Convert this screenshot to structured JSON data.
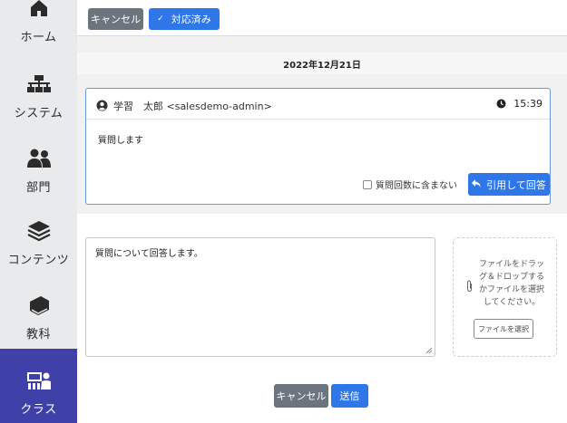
{
  "sidebar": {
    "items": [
      {
        "label": "ホーム",
        "icon": "home-icon"
      },
      {
        "label": "システム",
        "icon": "sitemap-icon"
      },
      {
        "label": "部門",
        "icon": "users-icon"
      },
      {
        "label": "コンテンツ",
        "icon": "layers-icon"
      },
      {
        "label": "教科",
        "icon": "book-icon"
      },
      {
        "label": "クラス",
        "icon": "chalkboard-teacher-icon",
        "active": true
      }
    ]
  },
  "toolbar": {
    "cancel_label": "キャンセル",
    "done_label": "対応済み"
  },
  "thread": {
    "date": "2022年12月21日",
    "message": {
      "author": "学習　太郎 <salesdemo-admin>",
      "time": "15:39",
      "body": "質問します",
      "exclude_label": "質問回数に含まない",
      "quote_label": "引用して回答"
    }
  },
  "reply": {
    "text": "質問について回答します。",
    "drop_text": "ファイルをドラッグ＆ドロップするかファイルを選択してください。",
    "file_button": "ファイルを選択",
    "cancel_label": "キャンセル",
    "send_label": "送信"
  },
  "colors": {
    "primary": "#2f77e8",
    "secondary": "#6c757d",
    "sidebar_active": "#3f40a8",
    "sidebar_bg": "#e9eaec"
  }
}
